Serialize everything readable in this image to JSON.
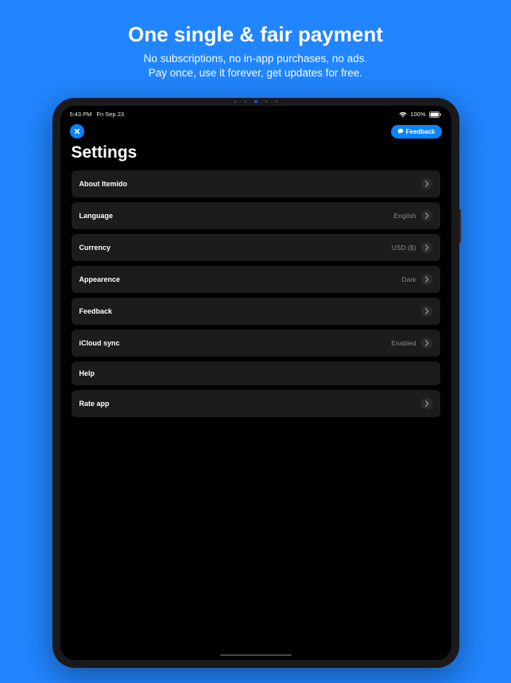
{
  "promo": {
    "title": "One single & fair payment",
    "line1": "No subscriptions, no in-app purchases, no ads.",
    "line2": "Pay once, use it forever, get updates for free."
  },
  "status_bar": {
    "time": "5:43 PM",
    "date": "Fri Sep 23",
    "battery_pct": "100%"
  },
  "top": {
    "feedback_label": "Feedback"
  },
  "page_title": "Settings",
  "settings": [
    {
      "label": "About Itemido",
      "value": "",
      "chevron": true
    },
    {
      "label": "Language",
      "value": "English",
      "chevron": true
    },
    {
      "label": "Currency",
      "value": "USD ($)",
      "chevron": true
    },
    {
      "label": "Appearence",
      "value": "Dark",
      "chevron": true
    },
    {
      "label": "Feedback",
      "value": "",
      "chevron": true
    },
    {
      "label": "iCloud sync",
      "value": "Enabled",
      "chevron": true
    },
    {
      "label": "Help",
      "value": "",
      "chevron": false
    },
    {
      "label": "Rate app",
      "value": "",
      "chevron": true
    }
  ]
}
